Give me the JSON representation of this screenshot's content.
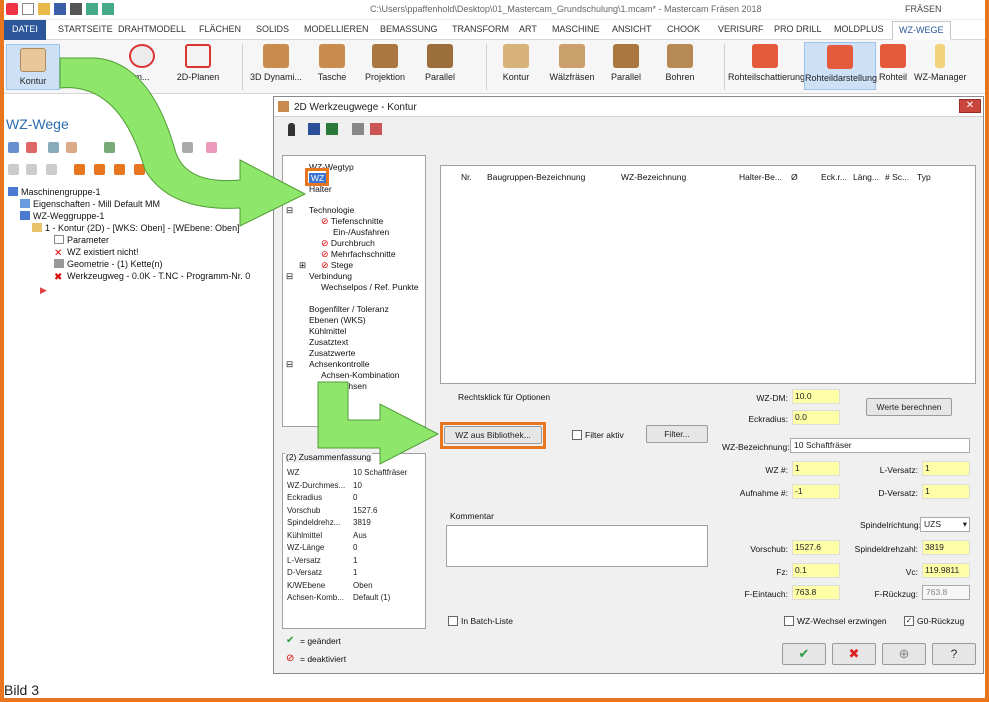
{
  "titlebar": {
    "path": "C:\\Users\\ppaffenhold\\Desktop\\01_Mastercam_Grundschulung\\1.mcam* - Mastercam Fräsen 2018",
    "mode": "FRÄSEN"
  },
  "tabs": [
    "DATEI",
    "STARTSEITE",
    "DRAHTMODELL",
    "FLÄCHEN",
    "SOLIDS",
    "MODELLIEREN",
    "BEMASSUNG",
    "TRANSFORM",
    "ART",
    "MASCHINE",
    "ANSICHT",
    "CHOOK",
    "VERISURF",
    "PRO DRILL",
    "MOLDPLUS",
    "WZ-WEGE"
  ],
  "ribbon": {
    "kontur": "Kontur",
    "planen": "2D-Planen",
    "dyn": "3D Dynami...",
    "tasche": "Tasche",
    "projektion": "Projektion",
    "parallel": "Parallel",
    "kontur2": "Kontur",
    "waelz": "Wälzfräsen",
    "parallel2": "Parallel",
    "bohren": "Bohren",
    "rohteil_sch": "Rohteilschattierung",
    "rohteil_dar": "Rohteildarstellung",
    "rohteil": "Rohteil",
    "wzman": "WZ-Manager"
  },
  "left": {
    "title": "WZ-Wege",
    "tree": [
      "Maschinengruppe-1",
      "Eigenschaften - Mill Default MM",
      "WZ-Weggruppe-1",
      "1 - Kontur (2D) - [WKS: Oben] - [WEbene: Oben]",
      "Parameter",
      "WZ existiert nicht!",
      "Geometrie - (1) Kette(n)",
      "Werkzeugweg - 0.0K - T.NC - Programm-Nr. 0"
    ],
    "caption": "Bild 3"
  },
  "dialog": {
    "title": "2D Werkzeugwege - Kontur",
    "nav": [
      "WZ-Wegtyp",
      "WZ",
      "Halter",
      "Technologie",
      "Tiefenschnitte",
      "Ein-/Ausfahren",
      "Durchbruch",
      "Mehrfachschnitte",
      "Stege",
      "Verbindung",
      "Wechselpos / Ref. Punkte",
      "Bogenfilter / Toleranz",
      "Ebenen (WKS)",
      "Kühlmittel",
      "Zusatztext",
      "Zusatzwerte",
      "Achsenkontrolle",
      "Achsen-Kombination",
      "Drehachsen"
    ],
    "columns": [
      "Nr.",
      "Baugruppen-Bezeichnung",
      "WZ-Bezeichnung",
      "Halter-Be...",
      "Ø",
      "Eck.r...",
      "Läng...",
      "# Sc...",
      "Typ"
    ],
    "summary_title": "(2) Zusammenfassung",
    "summary": [
      [
        "WZ",
        "10 Schaftfräser"
      ],
      [
        "WZ-Durchmes...",
        "10"
      ],
      [
        "Eckradius",
        "0"
      ],
      [
        "Vorschub",
        "1527.6"
      ],
      [
        "Spindeldrehz...",
        "3819"
      ],
      [
        "Kühlmittel",
        "Aus"
      ],
      [
        "WZ-Länge",
        "0"
      ],
      [
        "L-Versatz",
        "1"
      ],
      [
        "D-Versatz",
        "1"
      ],
      [
        "K/WEbene",
        "Oben"
      ],
      [
        "Achsen-Komb...",
        "Default (1)"
      ]
    ],
    "legend_changed": "= geändert",
    "legend_disabled": "= deaktiviert",
    "right_click": "Rechtsklick für Optionen",
    "btn_lib": "WZ aus Bibliothek...",
    "filter_active": "Filter aktiv",
    "btn_filter": "Filter...",
    "comment": "Kommentar",
    "batch": "In Batch-Liste",
    "wz_dm_l": "WZ-DM:",
    "wz_dm": "10.0",
    "eckr_l": "Eckradius:",
    "eckr": "0.0",
    "btn_calc": "Werte berechnen",
    "bez_l": "WZ-Bezeichnung:",
    "bez": "10 Schaftfräser",
    "wznr_l": "WZ #:",
    "wznr": "1",
    "lv_l": "L-Versatz:",
    "lv": "1",
    "aufn_l": "Aufnahme #:",
    "aufn": "-1",
    "dv_l": "D-Versatz:",
    "dv": "1",
    "spr_l": "Spindelrichtung:",
    "spr": "UZS",
    "vor_l": "Vorschub:",
    "vor": "1527.6",
    "sdz_l": "Spindeldrehzahl:",
    "sdz": "3819",
    "fz_l": "Fz:",
    "fz": "0.1",
    "vc_l": "Vc:",
    "vc": "119.9811",
    "fein_l": "F-Eintauch:",
    "fein": "763.8",
    "frueck_l": "F-Rückzug:",
    "frueck": "763.8",
    "wzw": "WZ-Wechsel erzwingen",
    "g0": "G0-Rückzug"
  },
  "colors": {
    "accent": "#e8761f",
    "arrow": "#8ee66a",
    "ribbon_tab": "#2b579a",
    "input": "#ffffa8"
  }
}
